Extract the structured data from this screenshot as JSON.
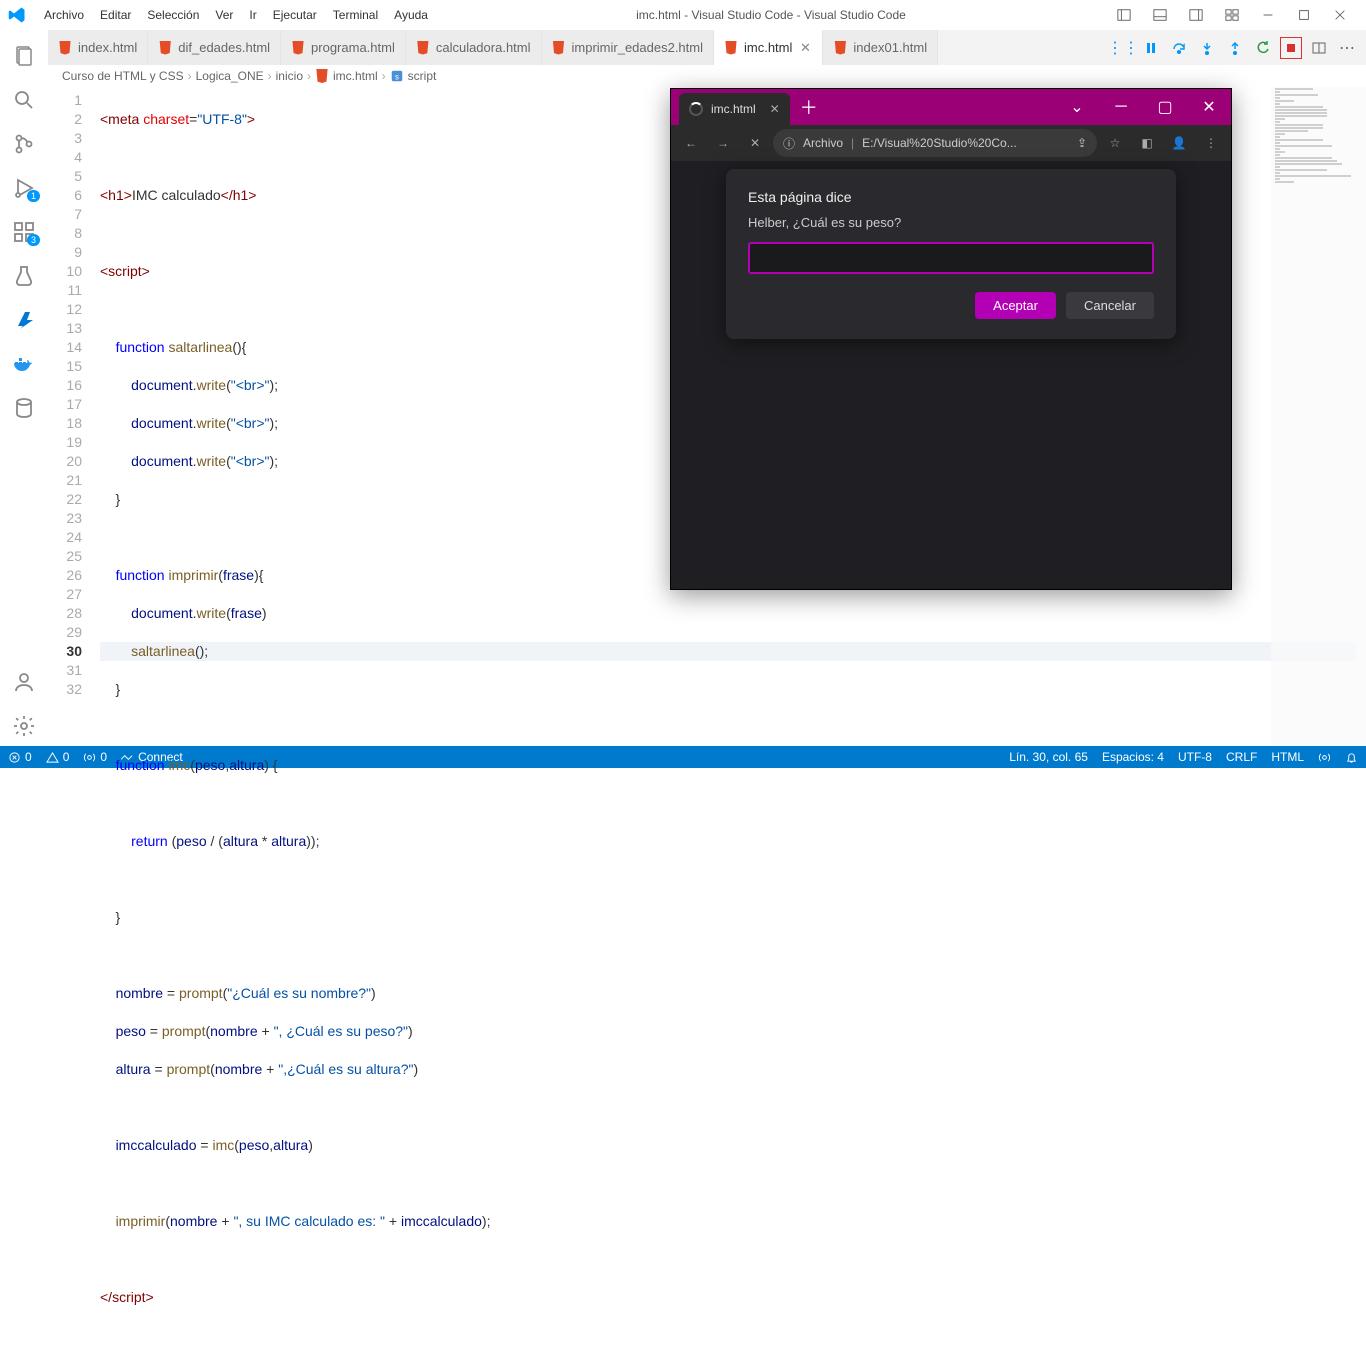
{
  "menubar": {
    "items": [
      "Archivo",
      "Editar",
      "Selección",
      "Ver",
      "Ir",
      "Ejecutar",
      "Terminal",
      "Ayuda"
    ],
    "title": "imc.html - Visual Studio Code - Visual Studio Code"
  },
  "activity": {
    "badge_run": "1",
    "badge_ext": "3"
  },
  "tabs": {
    "items": [
      {
        "label": "index.html"
      },
      {
        "label": "dif_edades.html"
      },
      {
        "label": "programa.html"
      },
      {
        "label": "calculadora.html"
      },
      {
        "label": "imprimir_edades2.html"
      },
      {
        "label": "imc.html",
        "active": true
      },
      {
        "label": "index01.html"
      }
    ]
  },
  "breadcrumb": {
    "segments": [
      "Curso de HTML y CSS",
      "Logica_ONE",
      "inicio",
      "imc.html",
      "script"
    ],
    "scriptIcon": "script"
  },
  "editor": {
    "lineNumbers": [
      "1",
      "2",
      "3",
      "4",
      "5",
      "6",
      "7",
      "8",
      "9",
      "10",
      "11",
      "12",
      "13",
      "14",
      "15",
      "16",
      "17",
      "18",
      "19",
      "20",
      "21",
      "22",
      "23",
      "24",
      "25",
      "26",
      "27",
      "28",
      "29",
      "30",
      "31",
      "32"
    ],
    "highlightLineIndex": 29
  },
  "statusbar": {
    "errors": "0",
    "warnings": "0",
    "broadcast": "0",
    "connect": "Connect",
    "position": "Lín. 30, col. 65",
    "spaces": "Espacios: 4",
    "encoding": "UTF-8",
    "eol": "CRLF",
    "lang": "HTML"
  },
  "browser": {
    "tabTitle": "imc.html",
    "urlLabel": "Archivo",
    "urlPath": "E:/Visual%20Studio%20Co...",
    "dialog": {
      "title": "Esta página dice",
      "message": "Helber, ¿Cuál es su peso?",
      "accept": "Aceptar",
      "cancel": "Cancelar"
    }
  }
}
